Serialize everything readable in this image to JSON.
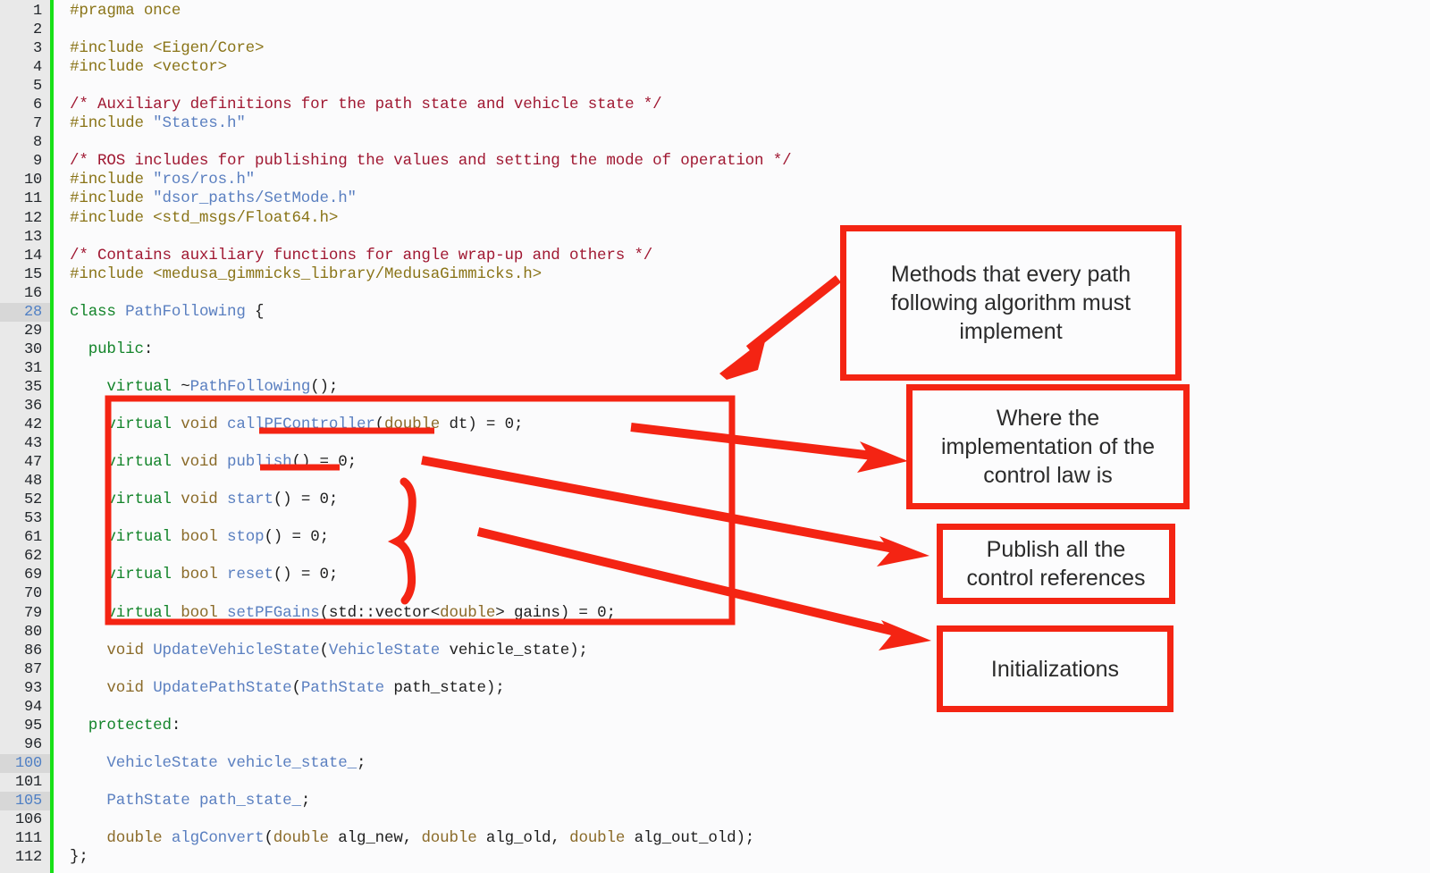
{
  "editor": {
    "language": "cpp",
    "gutter_color": "#e9e9e9",
    "gutter_rule_color": "#18e018",
    "background_color": "#fbfbfc",
    "highlight_color": "#d7d7d7",
    "annotation_color": "#f42413",
    "lines": [
      {
        "num": "1",
        "highlight": false,
        "tokens": [
          {
            "t": "pre",
            "s": "#pragma once"
          }
        ]
      },
      {
        "num": "2",
        "highlight": false,
        "tokens": []
      },
      {
        "num": "3",
        "highlight": false,
        "tokens": [
          {
            "t": "pre",
            "s": "#include <Eigen/Core>"
          }
        ]
      },
      {
        "num": "4",
        "highlight": false,
        "tokens": [
          {
            "t": "pre",
            "s": "#include <vector>"
          }
        ]
      },
      {
        "num": "5",
        "highlight": false,
        "tokens": []
      },
      {
        "num": "6",
        "highlight": false,
        "tokens": [
          {
            "t": "cmt",
            "s": "/* Auxiliary definitions for the path state and vehicle state */"
          }
        ]
      },
      {
        "num": "7",
        "highlight": false,
        "tokens": [
          {
            "t": "pre",
            "s": "#include "
          },
          {
            "t": "str",
            "s": "\"States.h\""
          }
        ]
      },
      {
        "num": "8",
        "highlight": false,
        "tokens": []
      },
      {
        "num": "9",
        "highlight": false,
        "tokens": [
          {
            "t": "cmt",
            "s": "/* ROS includes for publishing the values and setting the mode of operation */"
          }
        ]
      },
      {
        "num": "10",
        "highlight": false,
        "tokens": [
          {
            "t": "pre",
            "s": "#include "
          },
          {
            "t": "str",
            "s": "\"ros/ros.h\""
          }
        ]
      },
      {
        "num": "11",
        "highlight": false,
        "tokens": [
          {
            "t": "pre",
            "s": "#include "
          },
          {
            "t": "str",
            "s": "\"dsor_paths/SetMode.h\""
          }
        ]
      },
      {
        "num": "12",
        "highlight": false,
        "tokens": [
          {
            "t": "pre",
            "s": "#include <std_msgs/Float64.h>"
          }
        ]
      },
      {
        "num": "13",
        "highlight": false,
        "tokens": []
      },
      {
        "num": "14",
        "highlight": false,
        "tokens": [
          {
            "t": "cmt",
            "s": "/* Contains auxiliary functions for angle wrap-up and others */"
          }
        ]
      },
      {
        "num": "15",
        "highlight": false,
        "tokens": [
          {
            "t": "pre",
            "s": "#include <medusa_gimmicks_library/MedusaGimmicks.h>"
          }
        ]
      },
      {
        "num": "16",
        "highlight": false,
        "tokens": []
      },
      {
        "num": "28",
        "highlight": true,
        "tokens": [
          {
            "t": "kw",
            "s": "class"
          },
          {
            "t": "pun",
            "s": " "
          },
          {
            "t": "cls",
            "s": "PathFollowing"
          },
          {
            "t": "pun",
            "s": " {"
          }
        ]
      },
      {
        "num": "29",
        "highlight": false,
        "tokens": []
      },
      {
        "num": "30",
        "highlight": false,
        "tokens": [
          {
            "t": "pun",
            "s": "  "
          },
          {
            "t": "kw",
            "s": "public"
          },
          {
            "t": "pun",
            "s": ":"
          }
        ]
      },
      {
        "num": "31",
        "highlight": false,
        "tokens": []
      },
      {
        "num": "35",
        "highlight": false,
        "tokens": [
          {
            "t": "pun",
            "s": "    "
          },
          {
            "t": "kw",
            "s": "virtual"
          },
          {
            "t": "pun",
            "s": " ~"
          },
          {
            "t": "fn",
            "s": "PathFollowing"
          },
          {
            "t": "pun",
            "s": "();"
          }
        ]
      },
      {
        "num": "36",
        "highlight": false,
        "tokens": []
      },
      {
        "num": "42",
        "highlight": false,
        "tokens": [
          {
            "t": "pun",
            "s": "    "
          },
          {
            "t": "kw",
            "s": "virtual"
          },
          {
            "t": "pun",
            "s": " "
          },
          {
            "t": "typ",
            "s": "void"
          },
          {
            "t": "pun",
            "s": " "
          },
          {
            "t": "fn",
            "s": "callPFController"
          },
          {
            "t": "pun",
            "s": "("
          },
          {
            "t": "typ",
            "s": "double"
          },
          {
            "t": "pun",
            "s": " dt) = 0;"
          }
        ]
      },
      {
        "num": "43",
        "highlight": false,
        "tokens": []
      },
      {
        "num": "47",
        "highlight": false,
        "tokens": [
          {
            "t": "pun",
            "s": "    "
          },
          {
            "t": "kw",
            "s": "virtual"
          },
          {
            "t": "pun",
            "s": " "
          },
          {
            "t": "typ",
            "s": "void"
          },
          {
            "t": "pun",
            "s": " "
          },
          {
            "t": "fn",
            "s": "publish"
          },
          {
            "t": "pun",
            "s": "() = 0;"
          }
        ]
      },
      {
        "num": "48",
        "highlight": false,
        "tokens": []
      },
      {
        "num": "52",
        "highlight": false,
        "tokens": [
          {
            "t": "pun",
            "s": "    "
          },
          {
            "t": "kw",
            "s": "virtual"
          },
          {
            "t": "pun",
            "s": " "
          },
          {
            "t": "typ",
            "s": "void"
          },
          {
            "t": "pun",
            "s": " "
          },
          {
            "t": "fn",
            "s": "start"
          },
          {
            "t": "pun",
            "s": "() = 0;"
          }
        ]
      },
      {
        "num": "53",
        "highlight": false,
        "tokens": []
      },
      {
        "num": "61",
        "highlight": false,
        "tokens": [
          {
            "t": "pun",
            "s": "    "
          },
          {
            "t": "kw",
            "s": "virtual"
          },
          {
            "t": "pun",
            "s": " "
          },
          {
            "t": "typ",
            "s": "bool"
          },
          {
            "t": "pun",
            "s": " "
          },
          {
            "t": "fn",
            "s": "stop"
          },
          {
            "t": "pun",
            "s": "() = 0;"
          }
        ]
      },
      {
        "num": "62",
        "highlight": false,
        "tokens": []
      },
      {
        "num": "69",
        "highlight": false,
        "tokens": [
          {
            "t": "pun",
            "s": "    "
          },
          {
            "t": "kw",
            "s": "virtual"
          },
          {
            "t": "pun",
            "s": " "
          },
          {
            "t": "typ",
            "s": "bool"
          },
          {
            "t": "pun",
            "s": " "
          },
          {
            "t": "fn",
            "s": "reset"
          },
          {
            "t": "pun",
            "s": "() = 0;"
          }
        ]
      },
      {
        "num": "70",
        "highlight": false,
        "tokens": []
      },
      {
        "num": "79",
        "highlight": false,
        "tokens": [
          {
            "t": "pun",
            "s": "    "
          },
          {
            "t": "kw",
            "s": "virtual"
          },
          {
            "t": "pun",
            "s": " "
          },
          {
            "t": "typ",
            "s": "bool"
          },
          {
            "t": "pun",
            "s": " "
          },
          {
            "t": "fn",
            "s": "setPFGains"
          },
          {
            "t": "pun",
            "s": "(std::vector<"
          },
          {
            "t": "typ",
            "s": "double"
          },
          {
            "t": "pun",
            "s": "> gains) = 0;"
          }
        ]
      },
      {
        "num": "80",
        "highlight": false,
        "tokens": []
      },
      {
        "num": "86",
        "highlight": false,
        "tokens": [
          {
            "t": "pun",
            "s": "    "
          },
          {
            "t": "typ",
            "s": "void"
          },
          {
            "t": "pun",
            "s": " "
          },
          {
            "t": "fn",
            "s": "UpdateVehicleState"
          },
          {
            "t": "pun",
            "s": "("
          },
          {
            "t": "cls",
            "s": "VehicleState"
          },
          {
            "t": "pun",
            "s": " vehicle_state);"
          }
        ]
      },
      {
        "num": "87",
        "highlight": false,
        "tokens": []
      },
      {
        "num": "93",
        "highlight": false,
        "tokens": [
          {
            "t": "pun",
            "s": "    "
          },
          {
            "t": "typ",
            "s": "void"
          },
          {
            "t": "pun",
            "s": " "
          },
          {
            "t": "fn",
            "s": "UpdatePathState"
          },
          {
            "t": "pun",
            "s": "("
          },
          {
            "t": "cls",
            "s": "PathState"
          },
          {
            "t": "pun",
            "s": " path_state);"
          }
        ]
      },
      {
        "num": "94",
        "highlight": false,
        "tokens": []
      },
      {
        "num": "95",
        "highlight": false,
        "tokens": [
          {
            "t": "pun",
            "s": "  "
          },
          {
            "t": "kw",
            "s": "protected"
          },
          {
            "t": "pun",
            "s": ":"
          }
        ]
      },
      {
        "num": "96",
        "highlight": false,
        "tokens": []
      },
      {
        "num": "100",
        "highlight": true,
        "tokens": [
          {
            "t": "pun",
            "s": "    "
          },
          {
            "t": "cls",
            "s": "VehicleState"
          },
          {
            "t": "pun",
            "s": " "
          },
          {
            "t": "cls",
            "s": "vehicle_state_"
          },
          {
            "t": "pun",
            "s": ";"
          }
        ]
      },
      {
        "num": "101",
        "highlight": false,
        "tokens": []
      },
      {
        "num": "105",
        "highlight": true,
        "tokens": [
          {
            "t": "pun",
            "s": "    "
          },
          {
            "t": "cls",
            "s": "PathState"
          },
          {
            "t": "pun",
            "s": " "
          },
          {
            "t": "cls",
            "s": "path_state_"
          },
          {
            "t": "pun",
            "s": ";"
          }
        ]
      },
      {
        "num": "106",
        "highlight": false,
        "tokens": []
      },
      {
        "num": "111",
        "highlight": false,
        "tokens": [
          {
            "t": "pun",
            "s": "    "
          },
          {
            "t": "typ",
            "s": "double"
          },
          {
            "t": "pun",
            "s": " "
          },
          {
            "t": "fn",
            "s": "algConvert"
          },
          {
            "t": "pun",
            "s": "("
          },
          {
            "t": "typ",
            "s": "double"
          },
          {
            "t": "pun",
            "s": " alg_new, "
          },
          {
            "t": "typ",
            "s": "double"
          },
          {
            "t": "pun",
            "s": " alg_old, "
          },
          {
            "t": "typ",
            "s": "double"
          },
          {
            "t": "pun",
            "s": " alg_out_old);"
          }
        ]
      },
      {
        "num": "112",
        "highlight": false,
        "tokens": [
          {
            "t": "pun",
            "s": "};"
          }
        ]
      }
    ]
  },
  "annotations": {
    "methods_note": "Methods that every path following algorithm must implement",
    "control_law_note": "Where the implementation of the control law is",
    "publish_note": "Publish all the control references",
    "init_note": "Initializations"
  }
}
